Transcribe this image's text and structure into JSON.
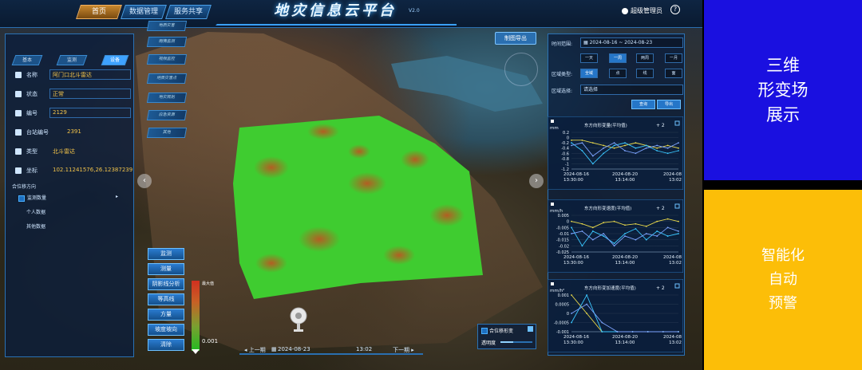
{
  "header": {
    "nav": [
      "首页",
      "数据管理",
      "服务共享"
    ],
    "title": "地灾信息云平台",
    "version": "V2.0",
    "user": "超级管理员"
  },
  "left_panel": {
    "breadcrumb": [
      "基本",
      "监测",
      "设备"
    ],
    "fields": [
      {
        "label": "名称",
        "value": "阿门口北斗雷达"
      },
      {
        "label": "状态",
        "value": "正常"
      },
      {
        "label": "编号",
        "value": "2129"
      },
      {
        "label": "台站编号",
        "value": "2391"
      },
      {
        "label": "类型",
        "value": "北斗雷达"
      },
      {
        "label": "坐标",
        "value": "102.11241576,26.12387239"
      }
    ],
    "tree": {
      "root": "合位移方向",
      "children": [
        "监测数量",
        "个人数据",
        "其他数据"
      ]
    }
  },
  "side_menu": [
    "地质灾害",
    "雨情监测",
    "视频监控",
    "地质灾害点",
    "地灾规划",
    "应急资源",
    "其他"
  ],
  "tools": [
    "监测",
    "测量",
    "阴影线分析",
    "等高线",
    "方量",
    "坡度坡向",
    "清除"
  ],
  "legend": {
    "max": "最大值",
    "min": "0.001"
  },
  "timebar": {
    "prev": "上一期",
    "date": "2024-08-23",
    "time": "13:02",
    "next": "下一期"
  },
  "map_export": "制图导出",
  "opacity": {
    "label": "合位移形变",
    "slider_label": "透明度",
    "value": 0.4
  },
  "right_panel": {
    "time_range_label": "时间范围:",
    "time_range": "2024-08-16 ~ 2024-08-23",
    "periods": [
      "一天",
      "一周",
      "两周",
      "一月"
    ],
    "active_period": "一周",
    "area_type_label": "区域类型:",
    "area_types": [
      "全域",
      "点",
      "线",
      "面"
    ],
    "active_area_type": "全域",
    "area_select_label": "区域选择:",
    "area_select_placeholder": "请选择",
    "query_btn": "查询",
    "export_btn": "导出"
  },
  "colors": {
    "series1": "#e8d84a",
    "series2": "#3ac7ff",
    "series3": "#7da4ff",
    "bg": "#0a1e3c"
  },
  "chart_data": [
    {
      "type": "line",
      "title": "东方向形变量(平均值)",
      "ylabel": "mm",
      "x": [
        "2024-08-16 13:30:00",
        "2024-08-20 13:14:00",
        "2024-08 13:02"
      ],
      "ylim": [
        -1.2,
        0.2
      ],
      "series": [
        {
          "values": [
            -0.1,
            -0.1,
            -0.2,
            -0.3,
            -0.4,
            -0.3,
            -0.2,
            -0.3,
            -0.4,
            -0.3,
            -0.4
          ]
        },
        {
          "values": [
            -0.2,
            -0.5,
            -1.0,
            -0.6,
            -0.3,
            -0.2,
            -0.4,
            -0.3,
            -0.5,
            -0.6,
            -0.5
          ]
        },
        {
          "values": [
            -0.3,
            -0.2,
            -0.7,
            -0.4,
            -0.2,
            -0.5,
            -0.6,
            -0.4,
            -0.3,
            -0.4,
            -0.2
          ]
        }
      ],
      "ticks": [
        0.2,
        0,
        -0.2,
        -0.4,
        -0.6,
        -0.8,
        -1,
        -1.2
      ]
    },
    {
      "type": "line",
      "title": "东方向形变速度(平均值)",
      "ylabel": "mm/h",
      "x": [
        "2024-08-16 13:30:00",
        "2024-08-20 13:14:00",
        "2024-08 13:02"
      ],
      "ylim": [
        -0.025,
        0.005
      ],
      "series": [
        {
          "values": [
            0.0,
            -0.002,
            -0.005,
            -0.001,
            0.0,
            -0.003,
            -0.002,
            -0.004,
            0.0,
            0.002,
            0.0
          ]
        },
        {
          "values": [
            -0.005,
            -0.02,
            -0.008,
            -0.012,
            -0.018,
            -0.01,
            -0.006,
            -0.015,
            -0.008,
            -0.012,
            -0.01
          ]
        },
        {
          "values": [
            -0.01,
            -0.008,
            -0.015,
            -0.01,
            -0.02,
            -0.012,
            -0.015,
            -0.01,
            -0.012,
            -0.005,
            -0.008
          ]
        }
      ],
      "ticks": [
        0.005,
        0,
        -0.005,
        -0.01,
        -0.015,
        -0.02,
        -0.025
      ]
    },
    {
      "type": "line",
      "title": "东方向形变加速度(平均值)",
      "ylabel": "mm/h²",
      "x": [
        "2024-08-16 13:30:00",
        "2024-08-20 13:14:00",
        "2024-08 13:02"
      ],
      "ylim": [
        -0.001,
        0.001
      ],
      "series": [
        {
          "values": [
            0.001,
            0.0,
            -0.001,
            -0.001,
            -0.001,
            -0.001,
            -0.001,
            -0.001
          ]
        },
        {
          "values": [
            -0.0005,
            0.001,
            -0.001,
            -0.001,
            -0.001,
            -0.001,
            -0.001,
            -0.001
          ]
        },
        {
          "values": [
            0.0,
            0.0005,
            -0.0005,
            -0.001,
            -0.001,
            -0.001,
            -0.001,
            -0.001
          ]
        }
      ],
      "ticks": [
        0.001,
        0.0005,
        0,
        -0.0005,
        -0.001
      ]
    }
  ],
  "overlay": {
    "block1": [
      "三维",
      "形变场",
      "展示"
    ],
    "block2": [
      "智能化",
      "自动",
      "预警"
    ]
  }
}
